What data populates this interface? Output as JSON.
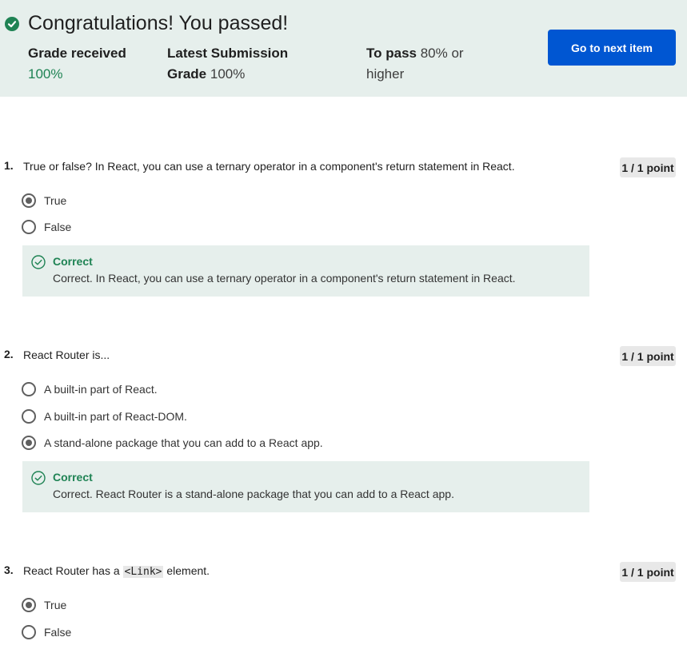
{
  "banner": {
    "title": "Congratulations! You passed!",
    "grade_label": "Grade received",
    "grade_value": "100%",
    "latest_label": "Latest Submission Grade",
    "latest_value": "100%",
    "to_pass_label": "To pass",
    "to_pass_value": "80% or higher",
    "next_button": "Go to next item"
  },
  "questions": [
    {
      "number": "1.",
      "text": "True or false? In React, you can use a ternary operator in a component's return statement in React.",
      "points": "1 / 1 point",
      "options": [
        "True",
        "False"
      ],
      "selected": 0,
      "feedback_title": "Correct",
      "feedback_text": "Correct. In React, you can use a ternary operator in a component's return statement in React."
    },
    {
      "number": "2.",
      "text": "React Router is...",
      "points": "1 / 1 point",
      "options": [
        "A built-in part of React.",
        "A built-in part of React-DOM.",
        "A stand-alone package that you can add to a React app."
      ],
      "selected": 2,
      "feedback_title": "Correct",
      "feedback_text": "Correct. React Router is a stand-alone package that you can add to a React app."
    },
    {
      "number": "3.",
      "text_before": "React Router has a",
      "text_code": "<Link>",
      "text_after": "element.",
      "points": "1 / 1 point",
      "options": [
        "True",
        "False"
      ],
      "selected": 0
    }
  ],
  "colors": {
    "accent": "#0056d2",
    "success": "#1f8354",
    "banner_bg": "#e6efec"
  },
  "icons": {
    "banner": "check-circle-icon",
    "feedback": "check-outline-icon"
  }
}
